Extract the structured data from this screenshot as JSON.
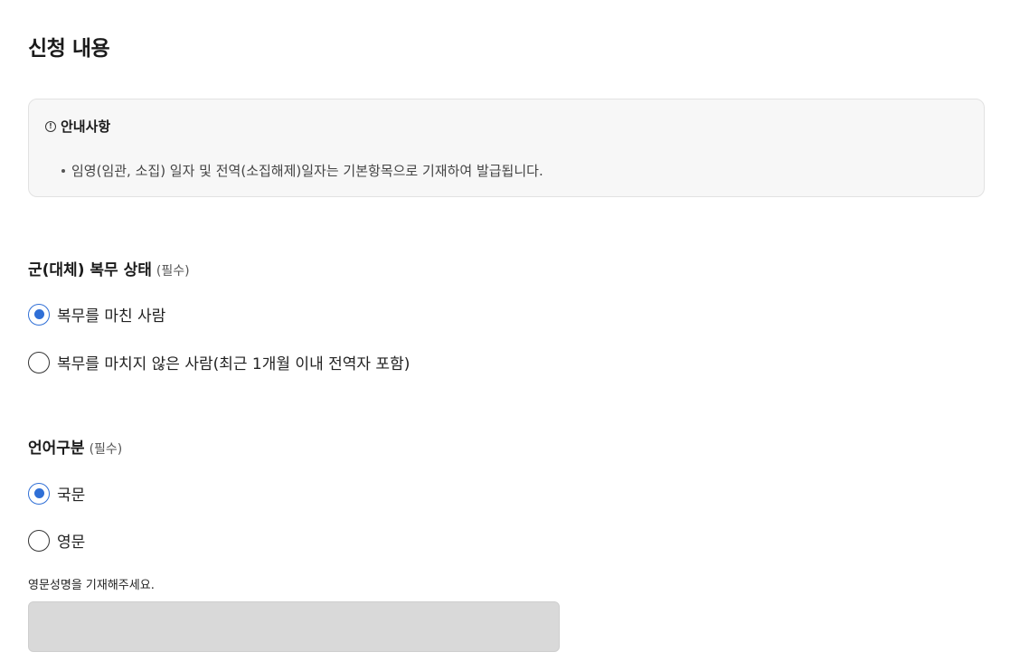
{
  "page": {
    "title": "신청 내용"
  },
  "notice": {
    "icon": "info-circle-icon",
    "title": "안내사항",
    "items": [
      "임영(임관, 소집) 일자 및 전역(소집해제)일자는 기본항목으로 기재하여 발급됩니다."
    ]
  },
  "military_status": {
    "label": "군(대체) 복무 상태",
    "required": "(필수)",
    "options": [
      {
        "label": "복무를 마친 사람",
        "checked": true
      },
      {
        "label": "복무를 마치지 않은 사람(최근 1개월 이내 전역자 포함)",
        "checked": false
      }
    ]
  },
  "language": {
    "label": "언어구분",
    "required": "(필수)",
    "options": [
      {
        "label": "국문",
        "checked": true
      },
      {
        "label": "영문",
        "checked": false
      }
    ]
  },
  "english_name": {
    "caption": "영문성명을 기재해주세요.",
    "value": "",
    "placeholder": ""
  },
  "colors": {
    "accent": "#2f6fd6",
    "notice_bg": "#f7f7f7",
    "input_disabled_bg": "#d9d9d9"
  }
}
